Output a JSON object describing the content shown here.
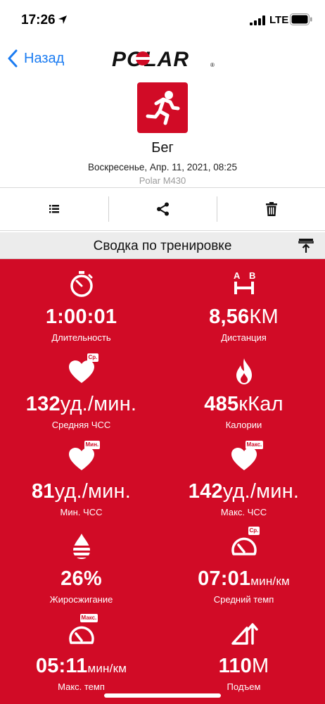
{
  "status_bar": {
    "time": "17:26",
    "network": "LTE"
  },
  "nav": {
    "back_label": "Назад",
    "logo_text": "POLAR"
  },
  "session": {
    "sport": "Бег",
    "date": "Воскресенье, Апр. 11, 2021, 08:25",
    "device": "Polar M430"
  },
  "summary": {
    "title": "Сводка по тренировке"
  },
  "stats": {
    "duration": {
      "value": "1:00:01",
      "unit": "",
      "label": "Длительность"
    },
    "distance": {
      "value": "8,56",
      "unit": "КМ",
      "label": "Дистанция"
    },
    "avg_hr": {
      "value": "132",
      "unit": "уд./мин.",
      "label": "Средняя ЧСС",
      "badge": "Ср."
    },
    "calories": {
      "value": "485",
      "unit": "кКал",
      "label": "Калории"
    },
    "min_hr": {
      "value": "81",
      "unit": "уд./мин.",
      "label": "Мин. ЧСС",
      "badge": "Мин."
    },
    "max_hr": {
      "value": "142",
      "unit": "уд./мин.",
      "label": "Макс. ЧСС",
      "badge": "Макс."
    },
    "fat_burn": {
      "value": "26%",
      "unit": "",
      "label": "Жиросжигание"
    },
    "avg_pace": {
      "value": "07:01",
      "unit": "мин/км",
      "label": "Средний темп",
      "badge": "Ср."
    },
    "max_pace": {
      "value": "05:11",
      "unit": "мин/км",
      "label": "Макс. темп",
      "badge": "Макс."
    },
    "ascent": {
      "value": "110",
      "unit": "М",
      "label": "Подъем"
    }
  },
  "colors": {
    "brand_red": "#d10b26",
    "ios_blue": "#1b7cf2"
  }
}
